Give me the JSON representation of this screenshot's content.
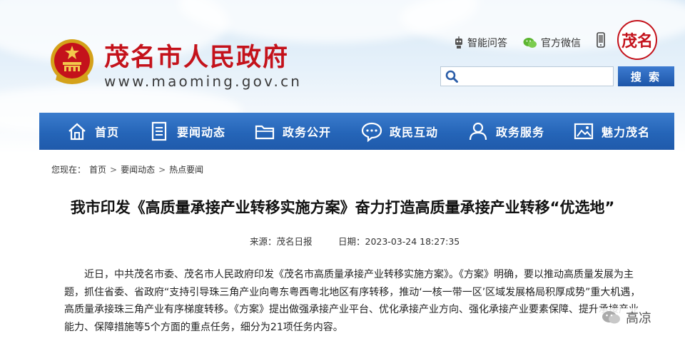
{
  "header": {
    "site_name": "茂名市人民政府",
    "site_url": "www.maoming.gov.cn",
    "links": [
      {
        "label": "智能问答",
        "icon": "robot-icon"
      },
      {
        "label": "官方微信",
        "icon": "wechat-icon"
      }
    ],
    "seal_text": "茂名",
    "search": {
      "placeholder": "",
      "button_label": "搜 索"
    }
  },
  "nav": {
    "items": [
      {
        "label": "首页",
        "icon": "home-icon"
      },
      {
        "label": "要闻动态",
        "icon": "document-icon"
      },
      {
        "label": "政务公开",
        "icon": "folder-icon"
      },
      {
        "label": "政民互动",
        "icon": "chat-icon"
      },
      {
        "label": "政务服务",
        "icon": "user-icon"
      },
      {
        "label": "魅力茂名",
        "icon": "picture-icon"
      }
    ]
  },
  "breadcrumb": {
    "prefix": "您现在：",
    "items": [
      "首页",
      "要闻动态",
      "热点要闻"
    ],
    "separator": ">"
  },
  "article": {
    "title": "我市印发《高质量承接产业转移实施方案》奋力打造高质量承接产业转移“优选地”",
    "source": "来源：茂名日报",
    "date": "日期：2023-03-24 18:27:35",
    "body": "近日，中共茂名市委、茂名市人民政府印发《茂名市高质量承接产业转移实施方案》。《方案》明确，要以推动高质量发展为主题，抓住省委、省政府“支持引导珠三角产业向粤东粤西粤北地区有序转移，推动‘一核一带一区’区域发展格局积厚成势”重大机遇，高质量承接珠三角产业有序梯度转移。《方案》提出做强承接产业平台、优化承接产业方向、强化承接产业要素保障、提升承接产业能力、保障措施等5个方面的重点任务，细分为21项任务内容。"
  },
  "watermark": {
    "text": "高凉"
  },
  "colors": {
    "brand_red": "#c4121b",
    "nav_blue": "#2565b8"
  }
}
